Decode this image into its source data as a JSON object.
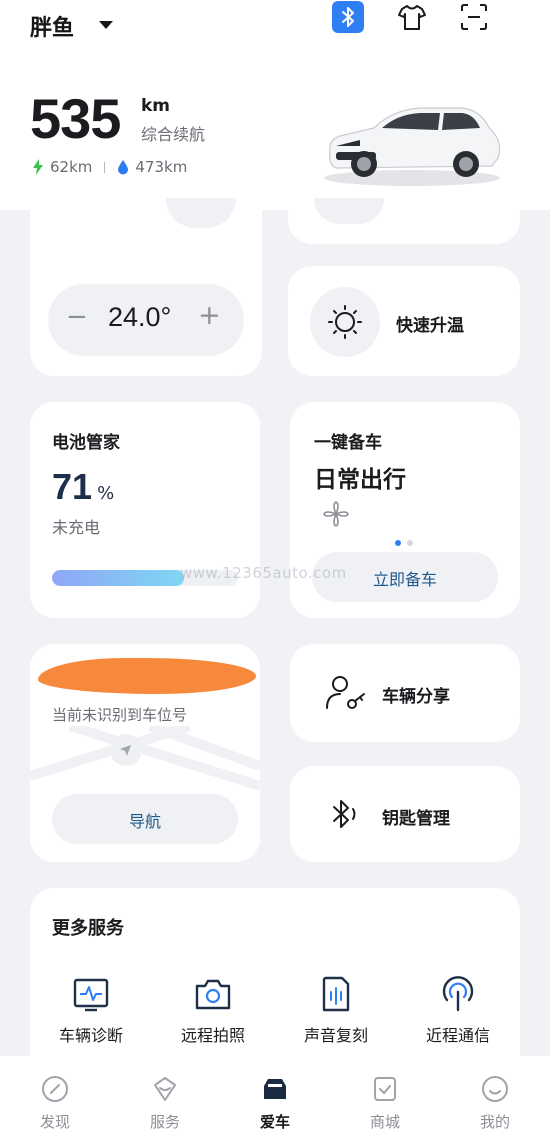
{
  "header": {
    "car_name": "胖鱼",
    "range_value": "535",
    "range_unit": "km",
    "range_label": "综合续航",
    "electric_range": "62km",
    "fuel_range": "473km"
  },
  "climate": {
    "temperature": "24.0°",
    "minus": "−",
    "plus": "+",
    "quick_heat_label": "快速升温"
  },
  "battery": {
    "title": "电池管家",
    "percent": "71",
    "percent_unit": "%",
    "charge_status": "未充电",
    "level": 0.71
  },
  "ready": {
    "title": "一键备车",
    "mode": "日常出行",
    "button_label": "立即备车",
    "page_indicator": {
      "count": 2,
      "active": 0
    }
  },
  "parking": {
    "status": "当前未识别到车位号",
    "nav_label": "导航"
  },
  "share": {
    "label": "车辆分享"
  },
  "key": {
    "label": "钥匙管理"
  },
  "services": {
    "title": "更多服务",
    "items": [
      {
        "label": "车辆诊断",
        "icon": "diagnostics-icon"
      },
      {
        "label": "远程拍照",
        "icon": "camera-icon"
      },
      {
        "label": "声音复刻",
        "icon": "voice-clone-icon"
      },
      {
        "label": "近程通信",
        "icon": "near-comm-icon"
      }
    ]
  },
  "tabs": [
    {
      "label": "发现",
      "icon": "discover-icon",
      "active": false
    },
    {
      "label": "服务",
      "icon": "service-icon",
      "active": false
    },
    {
      "label": "爱车",
      "icon": "car-icon",
      "active": true
    },
    {
      "label": "商城",
      "icon": "mall-icon",
      "active": false
    },
    {
      "label": "我的",
      "icon": "profile-icon",
      "active": false
    }
  ],
  "watermark": "www.12365auto.com",
  "colors": {
    "accent": "#2f7ff4",
    "electric": "#3fbf4f",
    "fuel": "#2e7cf0",
    "button_text": "#1f5a8c",
    "background": "#f1f2f5"
  }
}
